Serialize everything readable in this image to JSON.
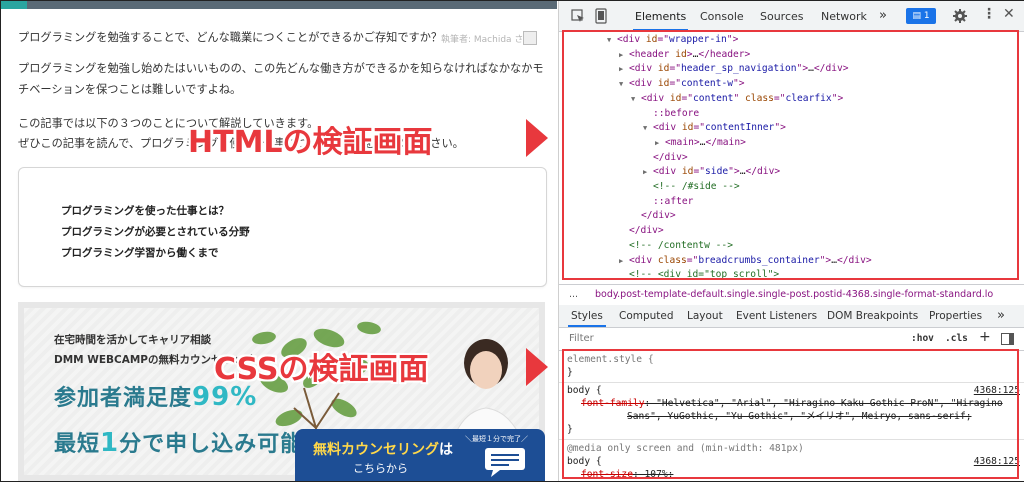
{
  "page": {
    "p1": "プログラミングを勉強することで、どんな職業につくことができるかご存知ですか？",
    "p2a": "プログラミングを勉強し始めたはいいものの、この先どんな働き方ができるかを知らなければなかなかモ",
    "p2b": "チベーションを保つことは難しいですよね。",
    "p3a": "この記事では以下の３つのことについて解説していきます。",
    "p3b": "ぜひこの記事を読んで、プログラミングを使った仕事についての理解を深めてください。",
    "author": "執筆者: Machida さん",
    "toc": [
      "プログラミングを使った仕事とは？",
      "プログラミングが必要とされている分野",
      "プログラミング学習から働くまで"
    ],
    "banner": {
      "line1": "在宅時間を活かしてキャリア相談",
      "line2": "DMM WEBCAMPの無料カウンセリング",
      "big1_pre": "参加者満足度",
      "big1_hl": "99%",
      "big2_pre": "最短",
      "big2_hl": "1",
      "big2_post": "分で申し込み可能",
      "cta_main": "無料カウンセリング",
      "cta_ha": "は",
      "cta_sub": "こちらから",
      "cta_badge": "＼最短１分で完了／"
    }
  },
  "devtools": {
    "tabs": [
      "Elements",
      "Console",
      "Sources",
      "Network"
    ],
    "more": "»",
    "issues_count": "1",
    "tree": [
      {
        "indent": 0,
        "arrow": "▼",
        "html": "<span class=\"ps\">&lt;div </span><span class=\"an\">id</span>=\"<span class=\"av\">wrapper-in</span>\"<span class=\"ps\">&gt;</span>"
      },
      {
        "indent": 1,
        "arrow": "▶",
        "html": "<span class=\"ps\">&lt;header </span><span class=\"an\">id</span><span class=\"ps\">&gt;</span><span class=\"tx\">…</span><span class=\"ps\">&lt;/header&gt;</span>"
      },
      {
        "indent": 1,
        "arrow": "▶",
        "html": "<span class=\"ps\">&lt;div </span><span class=\"an\">id</span>=\"<span class=\"av\">header_sp_navigation</span>\"<span class=\"ps\">&gt;</span><span class=\"tx\">…</span><span class=\"ps\">&lt;/div&gt;</span>"
      },
      {
        "indent": 1,
        "arrow": "▼",
        "html": "<span class=\"ps\">&lt;div </span><span class=\"an\">id</span>=\"<span class=\"av\">content-w</span>\"<span class=\"ps\">&gt;</span>"
      },
      {
        "indent": 2,
        "arrow": "▼",
        "html": "<span class=\"ps\">&lt;div </span><span class=\"an\">id</span>=\"<span class=\"av\">content</span>\" <span class=\"an\">class</span>=\"<span class=\"av\">clearfix</span>\"<span class=\"ps\">&gt;</span>"
      },
      {
        "indent": 3,
        "arrow": "",
        "html": "<span class=\"ps\">::before</span>"
      },
      {
        "indent": 3,
        "arrow": "▼",
        "html": "<span class=\"ps\">&lt;div </span><span class=\"an\">id</span>=\"<span class=\"av\">contentInner</span>\"<span class=\"ps\">&gt;</span>"
      },
      {
        "indent": 4,
        "arrow": "▶",
        "html": "<span class=\"ps\">&lt;main&gt;</span><span class=\"tx\">…</span><span class=\"ps\">&lt;/main&gt;</span>"
      },
      {
        "indent": 3,
        "arrow": "",
        "html": "<span class=\"ps\">&lt;/div&gt;</span>"
      },
      {
        "indent": 3,
        "arrow": "▶",
        "html": "<span class=\"ps\">&lt;div </span><span class=\"an\">id</span>=\"<span class=\"av\">side</span>\"<span class=\"ps\">&gt;</span><span class=\"tx\">…</span><span class=\"ps\">&lt;/div&gt;</span>"
      },
      {
        "indent": 3,
        "arrow": "",
        "html": "<span class=\"cm\">&lt;!-- /#side --&gt;</span>"
      },
      {
        "indent": 3,
        "arrow": "",
        "html": "<span class=\"ps\">::after</span>"
      },
      {
        "indent": 2,
        "arrow": "",
        "html": "<span class=\"ps\">&lt;/div&gt;</span>"
      },
      {
        "indent": 1,
        "arrow": "",
        "html": "<span class=\"ps\">&lt;/div&gt;</span>"
      },
      {
        "indent": 1,
        "arrow": "",
        "html": "<span class=\"cm\">&lt;!-- /contentw --&gt;</span>"
      },
      {
        "indent": 1,
        "arrow": "▶",
        "html": "<span class=\"ps\">&lt;div </span><span class=\"an\">class</span>=\"<span class=\"av\">breadcrumbs_container</span>\"<span class=\"ps\">&gt;</span><span class=\"tx\">…</span><span class=\"ps\">&lt;/div&gt;</span>"
      },
      {
        "indent": 1,
        "arrow": "",
        "html": "<span class=\"cm\">&lt;!-- &lt;div id=\"top_scroll\"&gt;</span>"
      }
    ],
    "crumb_dots": "...",
    "crumb": "body.post-template-default.single.single-post.postid-4368.single-format-standard.lo",
    "subtabs": [
      "Styles",
      "Computed",
      "Layout",
      "Event Listeners",
      "DOM Breakpoints",
      "Properties"
    ],
    "subtabs_more": "»",
    "filter_placeholder": "Filter",
    "hov": ":hov",
    "cls": ".cls",
    "plus": "+",
    "styles": {
      "element_style": "element.style {",
      "close": "}",
      "body_sel": "body {",
      "src1": "4368:125",
      "prop": "font-family",
      "val1": ": \"Helvetica\", \"Arial\", \"Hiragino Kaku Gothic ProN\", \"Hiragino",
      "val2": "Sans\", YuGothic, \"Yu Gothic\", \"メイリオ\", Meiryo, sans-serif;",
      "media": "@media only screen and (min-width: 481px)",
      "body_sel2": "body {",
      "src2": "4368:125",
      "prop2": "font-size",
      "val3": ": 107%;"
    }
  },
  "annotations": {
    "html_label": "HTMLの検証画面",
    "css_label": "CSSの検証画面",
    "color": "#e8383d"
  }
}
